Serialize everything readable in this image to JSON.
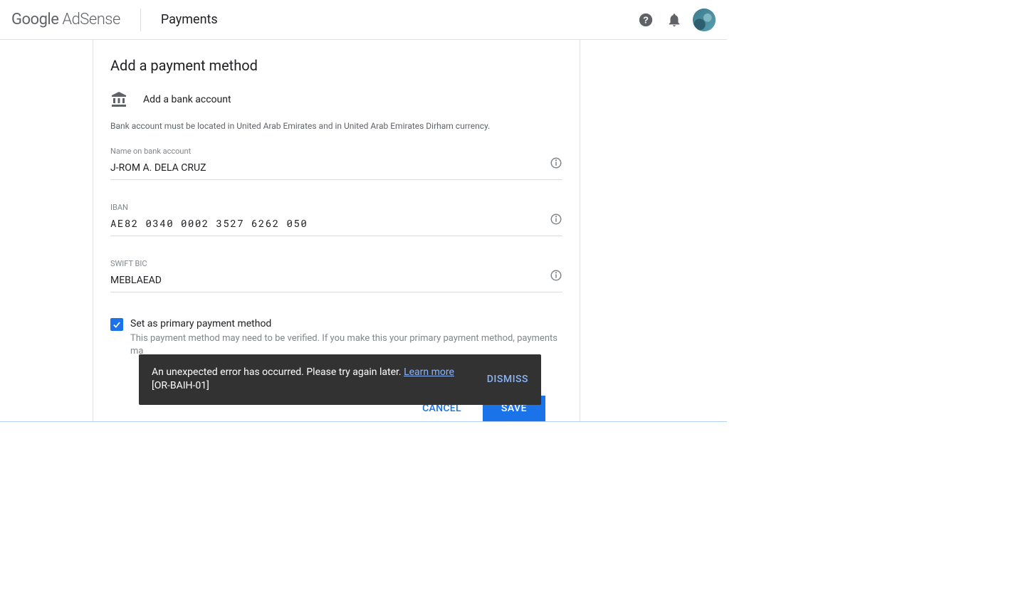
{
  "header": {
    "logo_google": "Google",
    "logo_adsense": " AdSense",
    "page_title": "Payments"
  },
  "card": {
    "title": "Add a payment method",
    "bank_row": "Add a bank account",
    "helper": "Bank account must be located in United Arab Emirates and in United Arab Emirates Dirham currency."
  },
  "fields": {
    "name_label": "Name on bank account",
    "name_value": "J-ROM A. DELA CRUZ",
    "iban_label": "IBAN",
    "iban_value": "AE82 0340 0002 3527 6262 050",
    "swift_label": "SWIFT BIC",
    "swift_value": "MEBLAEAD"
  },
  "checkbox": {
    "label": "Set as primary payment method",
    "sub": "This payment method may need to be verified. If you make this your primary payment method, payments ma"
  },
  "toast": {
    "msg": "An unexpected error has occurred. Please try again later. ",
    "learn_more": "Learn more",
    "code": "[OR-BAIH-01]",
    "dismiss": "DISMISS"
  },
  "actions": {
    "cancel": "CANCEL",
    "save": "SAVE"
  }
}
